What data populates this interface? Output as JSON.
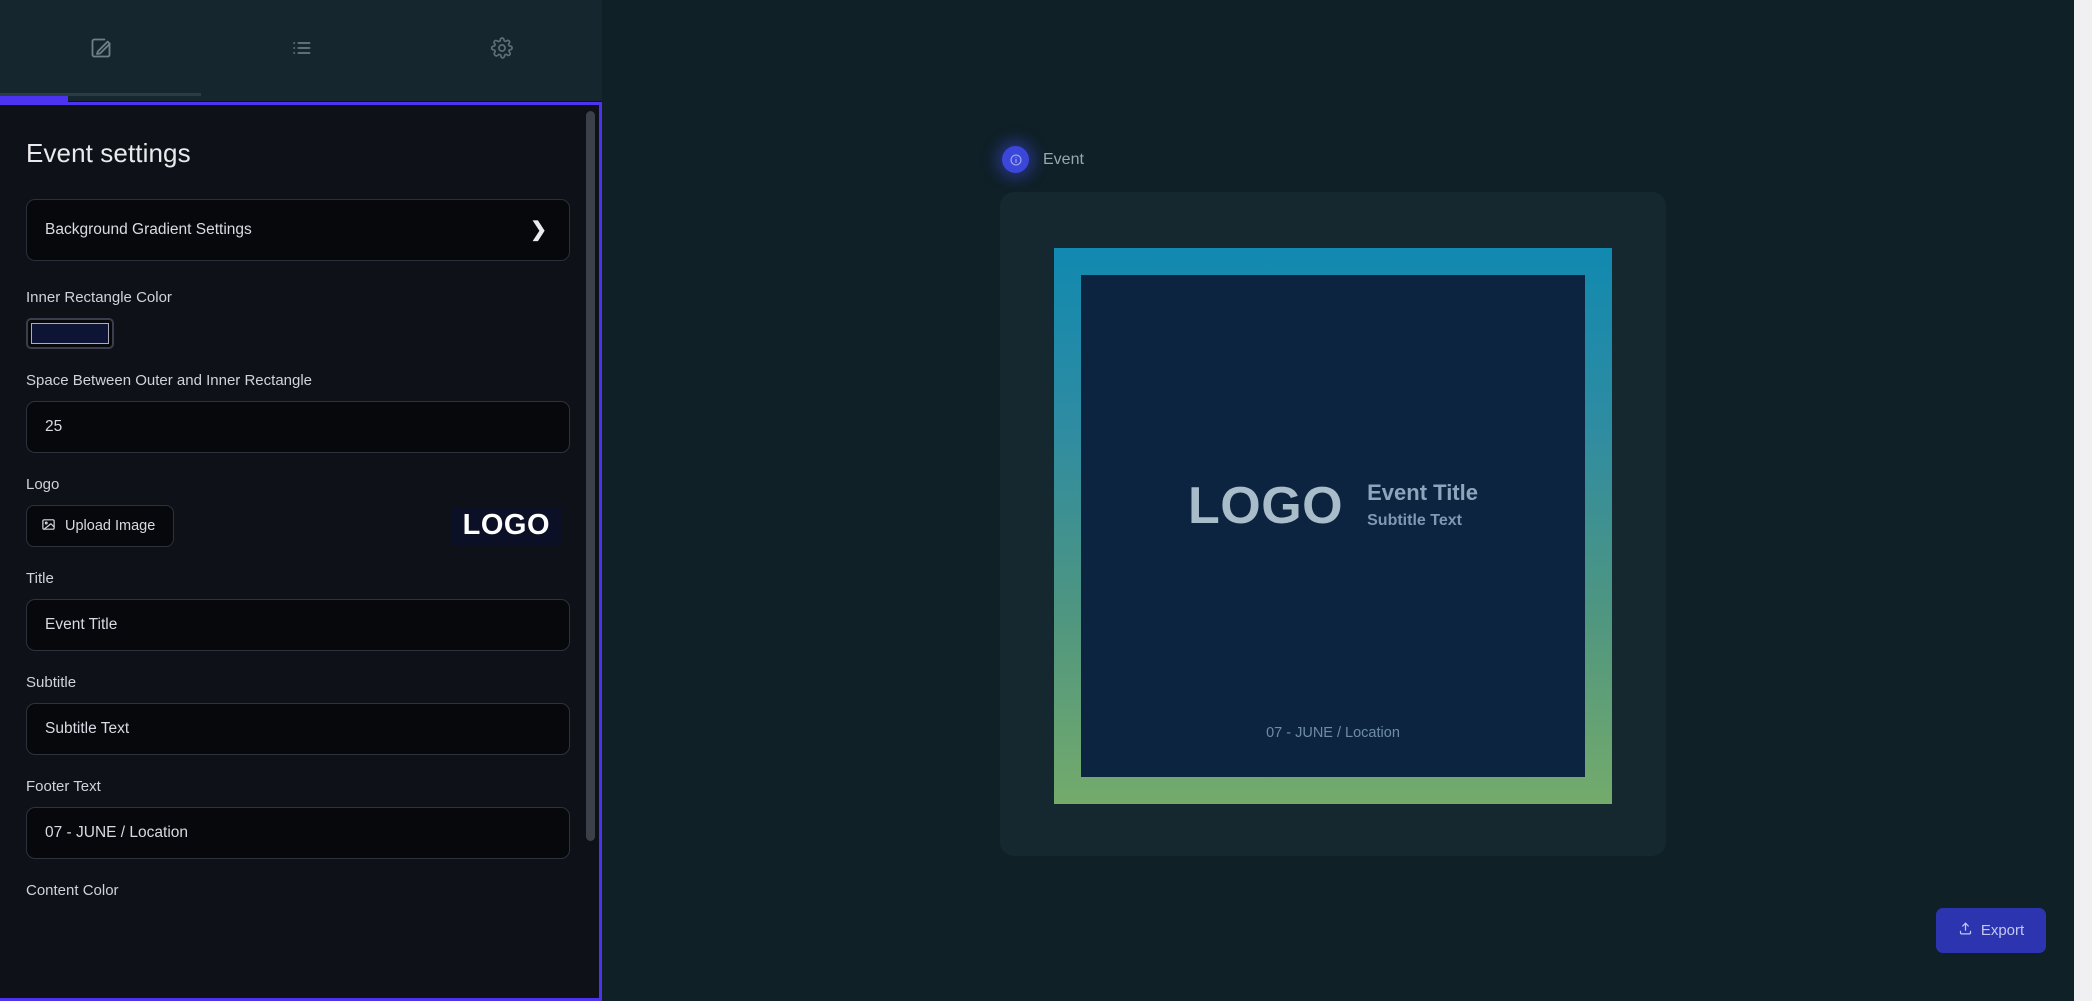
{
  "nav": {
    "tabs": [
      {
        "name": "edit",
        "icon": "edit-square-icon",
        "active": true
      },
      {
        "name": "list",
        "icon": "list-icon",
        "active": false
      },
      {
        "name": "settings",
        "icon": "gear-icon",
        "active": false
      }
    ]
  },
  "panel": {
    "title": "Event settings",
    "accordion": {
      "label": "Background Gradient Settings",
      "icon": "chevron-right-icon"
    },
    "fields": {
      "inner_rect_color_label": "Inner Rectangle Color",
      "inner_rect_color_value": "#0d1435",
      "space_label": "Space Between Outer and Inner Rectangle",
      "space_value": "25",
      "logo_label": "Logo",
      "upload_label": "Upload Image",
      "logo_preview_text": "LOGO",
      "title_label": "Title",
      "title_value": "Event Title",
      "subtitle_label": "Subtitle",
      "subtitle_value": "Subtitle Text",
      "footer_label": "Footer Text",
      "footer_value": "07 - JUNE / Location",
      "content_color_label": "Content Color"
    }
  },
  "preview": {
    "chip_label": "Event",
    "banner": {
      "logo_text": "LOGO",
      "title": "Event Title",
      "subtitle": "Subtitle Text",
      "footer": "07 - JUNE / Location",
      "inner_color": "#0d2440",
      "gradient_top": "#1189b0",
      "gradient_bottom": "#74ab6b"
    }
  },
  "actions": {
    "export_label": "Export"
  },
  "colors": {
    "accent_focus": "#4b33f0",
    "export_bg": "#2d34b0",
    "preview_bg": "#0f2027",
    "panel_bg": "#0e1117"
  }
}
